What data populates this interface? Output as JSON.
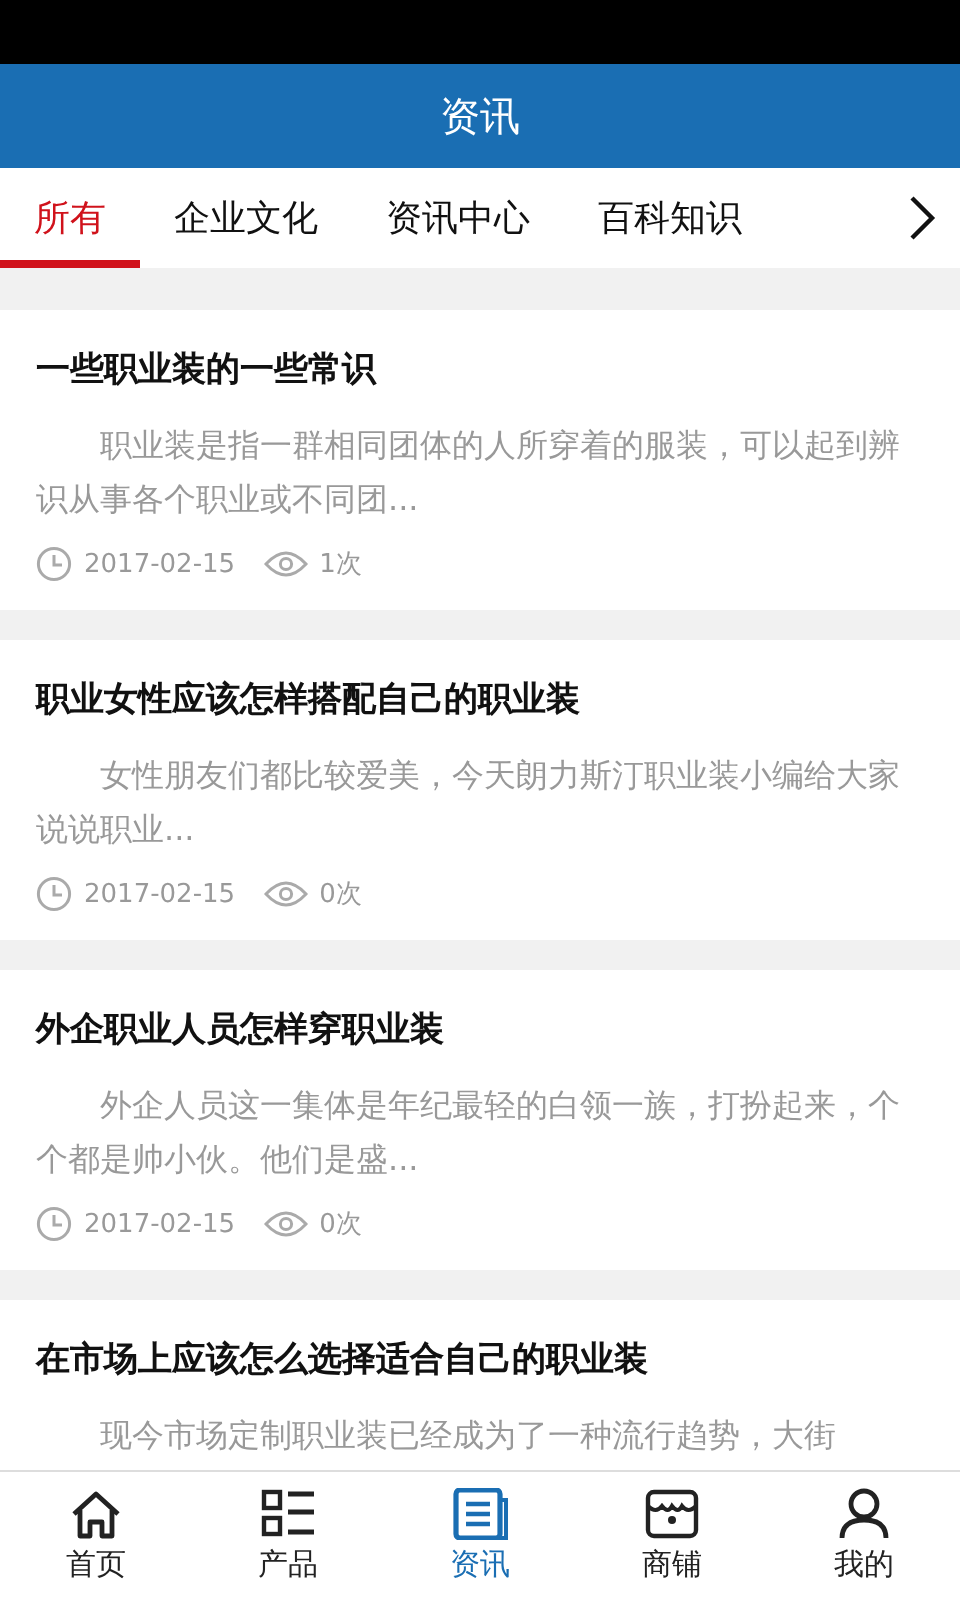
{
  "header": {
    "title": "资讯"
  },
  "tabs": [
    {
      "label": "所有",
      "selected": true
    },
    {
      "label": "企业文化",
      "selected": false
    },
    {
      "label": "资讯中心",
      "selected": false
    },
    {
      "label": "百科知识",
      "selected": false
    }
  ],
  "articles": [
    {
      "title": "一些职业装的一些常识",
      "summary": "职业装是指一群相同团体的人所穿着的服装，可以起到辨识从事各个职业或不同团...",
      "date": "2017-02-15",
      "views": "1次"
    },
    {
      "title": "职业女性应该怎样搭配自己的职业装",
      "summary": "女性朋友们都比较爱美，今天朗力斯汀职业装小编给大家说说职业...",
      "date": "2017-02-15",
      "views": "0次"
    },
    {
      "title": "外企职业人员怎样穿职业装",
      "summary": "外企人员这一集体是年纪最轻的白领一族，打扮起来，个个都是帅小伙。他们是盛...",
      "date": "2017-02-15",
      "views": "0次"
    },
    {
      "title": "在市场上应该怎么选择适合自己的职业装",
      "summary": "现今市场定制职业装已经成为了一种流行趋势，大街"
    }
  ],
  "nav": [
    {
      "kind": "home",
      "label": "首页",
      "selected": false
    },
    {
      "kind": "list",
      "label": "产品",
      "selected": false
    },
    {
      "kind": "news",
      "label": "资讯",
      "selected": true
    },
    {
      "kind": "shop",
      "label": "商铺",
      "selected": false
    },
    {
      "kind": "user",
      "label": "我的",
      "selected": false
    }
  ]
}
